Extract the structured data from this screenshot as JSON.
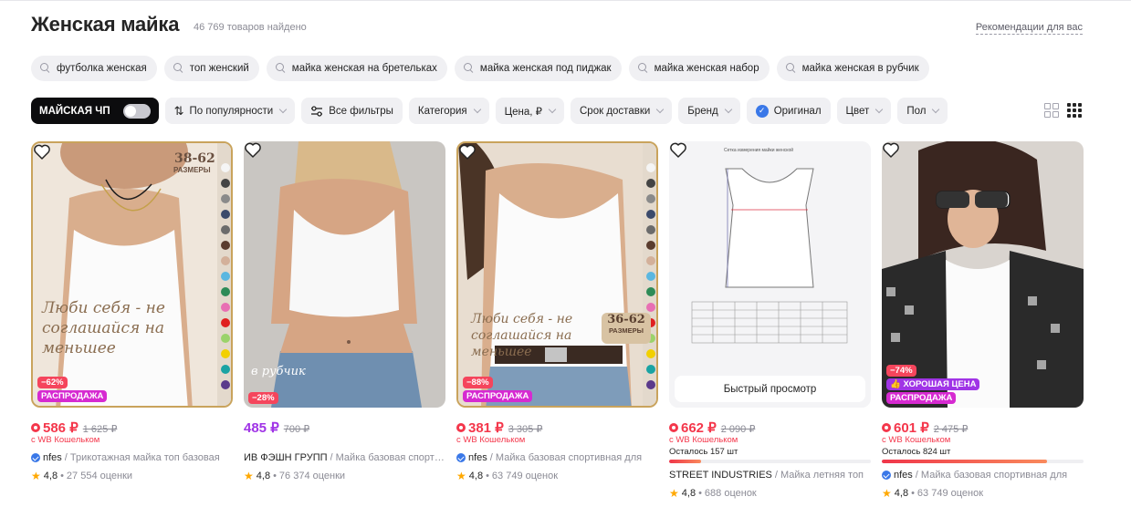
{
  "header": {
    "title": "Женская майка",
    "count": "46 769 товаров найдено",
    "recommendations": "Рекомендации для вас"
  },
  "search_chips": [
    "футболка женская",
    "топ женский",
    "майка женская на бретельках",
    "майка женская под пиджак",
    "майка женская набор",
    "майка женская в рубчик"
  ],
  "filters": {
    "toggle_label": "МАЙСКАЯ ЧП",
    "toggle_on": false,
    "sort": "По популярности",
    "all_filters": "Все фильтры",
    "category": "Категория",
    "price": "Цена, ₽",
    "delivery": "Срок доставки",
    "brand": "Бренд",
    "original": "Оригинал",
    "color": "Цвет",
    "gender": "Пол"
  },
  "products": [
    {
      "discount": "−62%",
      "sale": "РАСПРОДАЖА",
      "price": "586 ₽",
      "old_price": "1 625 ₽",
      "wallet": "с WB Кошельком",
      "brand": "nfes",
      "title": "Трикотажная майка топ базовая",
      "rating": "4,8",
      "reviews": "27 554 оценки",
      "image_text_1": "38-62",
      "image_text_2": "РАЗМЕРЫ",
      "image_text_3": "Люби себя - не соглашайся на меньшее"
    },
    {
      "discount": "−28%",
      "price": "485 ₽",
      "old_price": "700 ₽",
      "brand": "ИВ ФЭШН ГРУПП",
      "title": "Майка базовая спортивная",
      "rating": "4,8",
      "reviews": "76 374 оценки",
      "image_text_1": "в рубчик"
    },
    {
      "discount": "−88%",
      "sale": "РАСПРОДАЖА",
      "price": "381 ₽",
      "old_price": "3 305 ₽",
      "wallet": "с WB Кошельком",
      "brand": "nfes",
      "title": "Майка базовая спортивная для",
      "rating": "4,8",
      "reviews": "63 749 оценок",
      "image_text_1": "36-62",
      "image_text_2": "РАЗМЕРЫ",
      "image_text_3": "Люби себя - не соглашайся на меньшее"
    },
    {
      "price": "662 ₽",
      "old_price": "2 090 ₽",
      "wallet": "с WB Кошельком",
      "stock": "Осталось 157 шт",
      "stock_fill": 0.16,
      "brand": "STREET INDUSTRIES",
      "title": "Майка летняя топ",
      "rating": "4,8",
      "reviews": "688 оценок",
      "quick_view": "Быстрый просмотр",
      "image_text_1": "Сетка измерения майки женской"
    },
    {
      "discount": "−74%",
      "good_price": "ХОРОШАЯ ЦЕНА",
      "sale": "РАСПРОДАЖА",
      "price": "601 ₽",
      "old_price": "2 475 ₽",
      "wallet": "с WB Кошельком",
      "stock": "Осталось 824 шт",
      "stock_fill": 0.82,
      "brand": "nfes",
      "title": "Майка базовая спортивная для",
      "rating": "4,8",
      "reviews": "63 749 оценок"
    }
  ],
  "colors": {
    "accent_red": "#f4374b",
    "violet": "#a034e6",
    "sale_pink": "#d62ad1",
    "check_blue": "#3a78e8"
  }
}
